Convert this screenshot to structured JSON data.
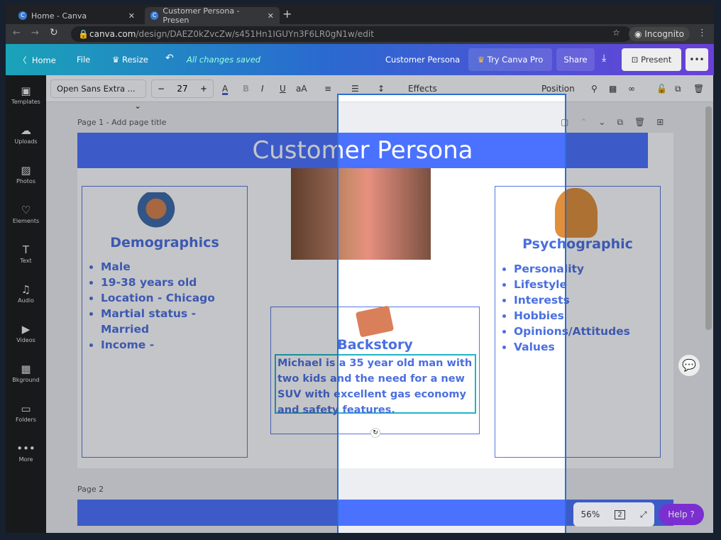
{
  "browser": {
    "tabs": [
      {
        "label": "Home - Canva"
      },
      {
        "label": "Customer Persona - Presen"
      }
    ],
    "url_host": "canva.com",
    "url_path": "/design/DAEZ0kZvcZw/s451Hn1IGUYn3F6LR0gN1w/edit",
    "profile": "Incognito"
  },
  "topbar": {
    "home": "Home",
    "file": "File",
    "resize": "Resize",
    "saved": "All changes saved",
    "doc_title": "Customer Persona",
    "try_pro": "Try Canva Pro",
    "share": "Share",
    "present": "Present"
  },
  "toolbar": {
    "font": "Open Sans Extra ...",
    "size": "27",
    "effects": "Effects",
    "position": "Position"
  },
  "sidebar": {
    "items": [
      {
        "label": "Templates",
        "icon": "▣"
      },
      {
        "label": "Uploads",
        "icon": "☁"
      },
      {
        "label": "Photos",
        "icon": "▨"
      },
      {
        "label": "Elements",
        "icon": "♡"
      },
      {
        "label": "Text",
        "icon": "T"
      },
      {
        "label": "Audio",
        "icon": "♫"
      },
      {
        "label": "Videos",
        "icon": "▶"
      },
      {
        "label": "Bkground",
        "icon": "▦"
      },
      {
        "label": "Folders",
        "icon": "▭"
      },
      {
        "label": "More",
        "icon": "•••"
      }
    ]
  },
  "page1": {
    "label": "Page 1 - Add page title",
    "title": "Customer Persona",
    "demographics": {
      "heading": "Demographics",
      "items": [
        "Male",
        "19-38 years old",
        "Location - Chicago",
        "Martial status - Married",
        "Income -"
      ]
    },
    "psychographic": {
      "heading": "Psychographic",
      "items": [
        "Personality",
        "Lifestyle",
        "Interests",
        "Hobbies",
        "Opinions/Attitudes",
        "Values"
      ]
    },
    "backstory": {
      "heading": "Backstory",
      "text": "Michael is a 35 year old man with two kids and the need for a new SUV with excellent gas economy and safety features."
    }
  },
  "page2": {
    "label": "Page 2"
  },
  "bottom": {
    "zoom": "56%",
    "pages": "2",
    "help": "Help ?"
  },
  "colors": {
    "accent": "#4a72ff",
    "text_blue": "#4a6fe0",
    "help": "#7b2fd0"
  }
}
